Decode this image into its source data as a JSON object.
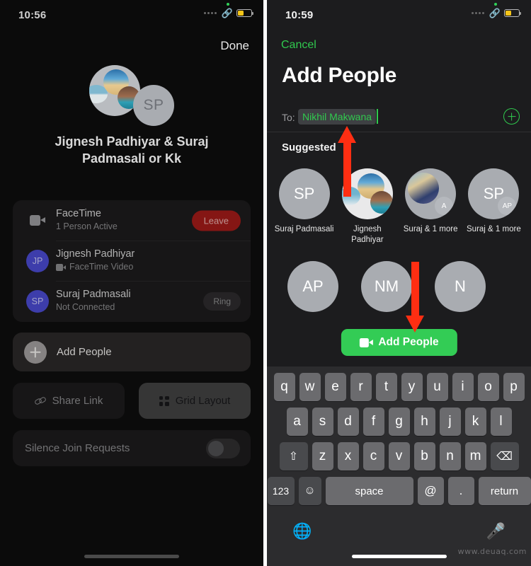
{
  "colors": {
    "accent_green": "#30c94e",
    "button_green": "#33cc55",
    "leave_red": "#a21b18",
    "arrow_red": "#ff2e12",
    "battery_yellow": "#f5c518",
    "panel_left_bg": "#0b0b0b",
    "panel_right_bg": "#1c1c1e",
    "keyboard_bg": "#2c2c2e",
    "key_bg": "#6b6b6e"
  },
  "left_panel": {
    "status_bar": {
      "time": "10:56",
      "icons": [
        "green-recording-dot",
        "signal-dots",
        "shareplay-link-icon",
        "battery-low-power-icon"
      ]
    },
    "done_label": "Done",
    "avatar_group": {
      "photo_avatar_name": "group-photo-avatar",
      "initials_avatar": "SP"
    },
    "call_title": "Jignesh Padhiyar & Suraj Padmasali or Kk",
    "roster": [
      {
        "icon": "video-camera-icon",
        "title": "FaceTime",
        "subtitle": "1 Person Active",
        "action": "Leave",
        "action_style": "leave"
      },
      {
        "icon": "JP",
        "title": "Jignesh Padhiyar",
        "subtitle": "FaceTime Video",
        "subtitle_icon": "video-camera-icon",
        "action": "",
        "action_style": "none"
      },
      {
        "icon": "SP",
        "title": "Suraj Padmasali",
        "subtitle": "Not Connected",
        "action": "Ring",
        "action_style": "ring"
      }
    ],
    "add_people_label": "Add People",
    "share_link_label": "Share Link",
    "grid_layout_label": "Grid Layout",
    "silence_label": "Silence Join Requests",
    "silence_toggle_state": "off"
  },
  "right_panel": {
    "status_bar": {
      "time": "10:59",
      "icons": [
        "green-recording-dot",
        "signal-dots",
        "shareplay-link-icon",
        "battery-low-power-icon"
      ]
    },
    "cancel_label": "Cancel",
    "title": "Add People",
    "to_field": {
      "label": "To:",
      "token": "Nikhil Makwana",
      "add_contact_icon": "plus-circle-icon"
    },
    "suggested_header": "Suggested",
    "suggested_row1": [
      {
        "avatar": "SP",
        "avatar_type": "initials",
        "name": "Suraj Padmasali",
        "badge": ""
      },
      {
        "avatar": "",
        "avatar_type": "photo-group",
        "name": "Jignesh Padhiyar",
        "badge": ""
      },
      {
        "avatar": "",
        "avatar_type": "photo",
        "name": "Suraj & 1 more",
        "badge": "A"
      },
      {
        "avatar": "SP",
        "avatar_type": "initials",
        "name": "Suraj & 1 more",
        "badge": "AP"
      }
    ],
    "suggested_row2": [
      {
        "avatar": "AP",
        "avatar_type": "initials",
        "name": "",
        "badge": ""
      },
      {
        "avatar": "NM",
        "avatar_type": "initials",
        "name": "",
        "badge": ""
      },
      {
        "avatar": "N",
        "avatar_type": "initials",
        "name": "",
        "badge": ""
      }
    ],
    "add_people_button": {
      "label": "Add People",
      "icon": "video-camera-icon"
    },
    "keyboard": {
      "row1": [
        "q",
        "w",
        "e",
        "r",
        "t",
        "y",
        "u",
        "i",
        "o",
        "p"
      ],
      "row2": [
        "a",
        "s",
        "d",
        "f",
        "g",
        "h",
        "j",
        "k",
        "l"
      ],
      "row3_shift": "shift-icon",
      "row3": [
        "z",
        "x",
        "c",
        "v",
        "b",
        "n",
        "m"
      ],
      "row3_backspace": "backspace-icon",
      "row4": {
        "numbers": "123",
        "emoji": "emoji-icon",
        "space": "space",
        "at": "@",
        "dot": ".",
        "return": "return"
      },
      "globe": "globe-icon",
      "mic": "microphone-icon"
    }
  },
  "watermark": "www.deuaq.com"
}
